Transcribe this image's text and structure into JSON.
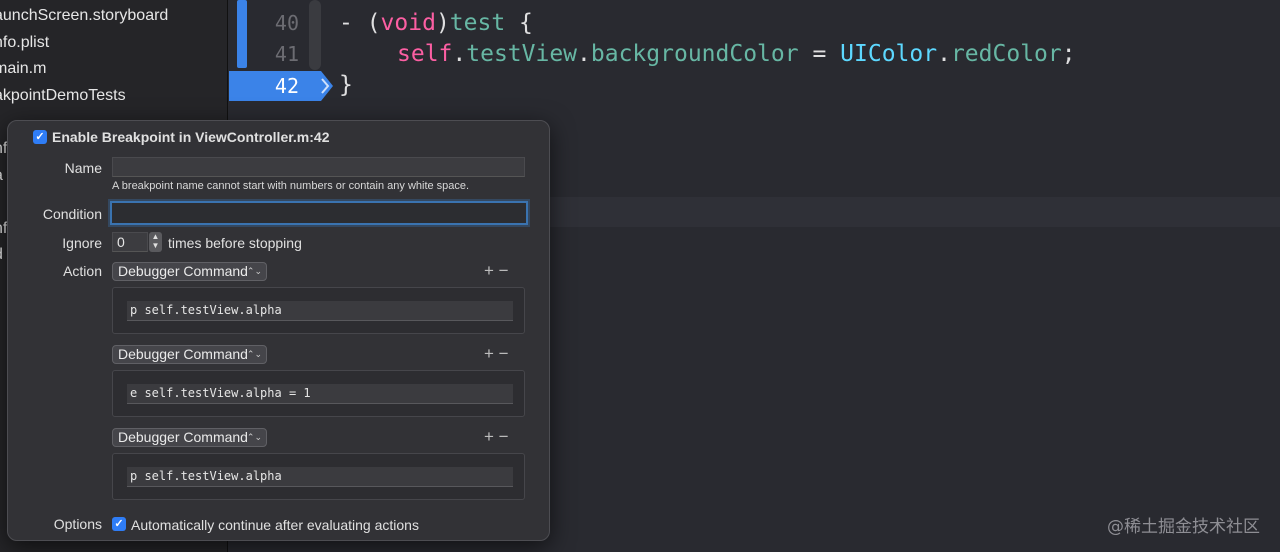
{
  "sidebar": {
    "items": [
      {
        "label": "aunchScreen.storyboard"
      },
      {
        "label": "nfo.plist"
      },
      {
        "label": "main.m"
      },
      {
        "label": "akpointDemoTests"
      },
      {
        "label": ""
      },
      {
        "label": "nf"
      },
      {
        "label": "a"
      },
      {
        "label": "r"
      },
      {
        "label": "nf"
      },
      {
        "label": "d"
      }
    ]
  },
  "editor": {
    "line_numbers": [
      "40",
      "41",
      "42"
    ],
    "code": {
      "line40_dash": "- (",
      "line40_void": "void",
      "line40_close": ")",
      "line40_test": "test",
      "line40_brace": " {",
      "line41_self": "self",
      "line41_dot1": ".",
      "line41_testView": "testView",
      "line41_dot2": ".",
      "line41_bg": "backgroundColor",
      "line41_eq": " = ",
      "line41_uicolor": "UIColor",
      "line41_dot3": ".",
      "line41_red": "redColor",
      "line41_semi": ";",
      "line42": "}"
    },
    "breakpoint_line": "42",
    "colors": {
      "breakpoint": "#3b83e8",
      "keyword": "#fc5fa3",
      "function": "#67b7a4",
      "class": "#5dd8ff"
    }
  },
  "popover": {
    "enable_label": "Enable Breakpoint in ViewController.m:42",
    "enable_checked": true,
    "name_label": "Name",
    "name_value": "",
    "name_hint": "A breakpoint name cannot start with numbers or contain any white space.",
    "condition_label": "Condition",
    "condition_value": "",
    "ignore_label": "Ignore",
    "ignore_value": "0",
    "ignore_suffix": "times before stopping",
    "action_label": "Action",
    "actions": [
      {
        "type": "Debugger Command",
        "command": "p self.testView.alpha"
      },
      {
        "type": "Debugger Command",
        "command": "e self.testView.alpha = 1"
      },
      {
        "type": "Debugger Command",
        "command": "p self.testView.alpha"
      }
    ],
    "add_remove": "+ −",
    "options_label": "Options",
    "auto_continue_label": "Automatically continue after evaluating actions",
    "auto_continue_checked": true
  },
  "watermark": "@稀土掘金技术社区"
}
